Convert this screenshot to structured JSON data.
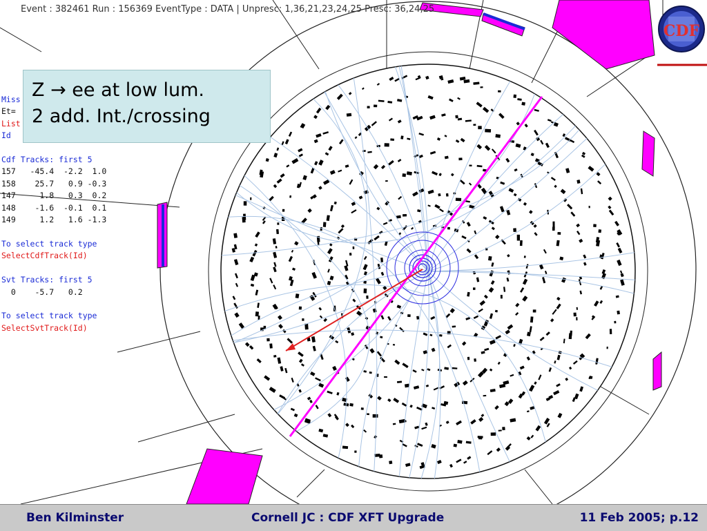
{
  "header": {
    "event_info": "Event : 382461  Run : 156369  EventType : DATA | Unpresc: 1,36,21,23,24,25 Presc: 36,24,25"
  },
  "panel": {
    "lines": [
      {
        "text": "Miss",
        "color": "blue"
      },
      {
        "text": "Et=",
        "color": "black"
      },
      {
        "text": "List",
        "color": "red"
      },
      {
        "text": "Id    pt    phi   eta",
        "color": "blue"
      },
      {
        "text": "",
        "color": "black"
      },
      {
        "text": "Cdf Tracks: first 5",
        "color": "blue"
      },
      {
        "text": "157   -45.4  -2.2  1.0",
        "color": "black"
      },
      {
        "text": "158    25.7   0.9 -0.3",
        "color": "black"
      },
      {
        "text": "147     1.8   0.3  0.2",
        "color": "black"
      },
      {
        "text": "148    -1.6  -0.1  0.1",
        "color": "black"
      },
      {
        "text": "149     1.2   1.6 -1.3",
        "color": "black"
      },
      {
        "text": "",
        "color": "black"
      },
      {
        "text": "To select track type",
        "color": "blue"
      },
      {
        "text": "SelectCdfTrack(Id)",
        "color": "red"
      },
      {
        "text": "",
        "color": "black"
      },
      {
        "text": "Svt Tracks: first 5",
        "color": "blue"
      },
      {
        "text": "  0    -5.7   0.2",
        "color": "black"
      },
      {
        "text": "",
        "color": "black"
      },
      {
        "text": "To select track type",
        "color": "blue"
      },
      {
        "text": "SelectSvtTrack(Id)",
        "color": "red"
      }
    ]
  },
  "callout": {
    "line1": "Z → ee at low lum.",
    "line2": "2 add. Int./crossing"
  },
  "logo": {
    "text": "CDF"
  },
  "footer": {
    "left": "Ben Kilminster",
    "center": "Cornell JC : CDF XFT Upgrade",
    "right": "11 Feb 2005; p.12"
  },
  "colors": {
    "calorimeter": "#ff00ff",
    "track_lines": "#a9c4e4",
    "vertex_rings": "#2b2be0",
    "electron_track": "#e02020",
    "callout_bg": "#cfe9ec",
    "footer_bg": "#c9c9c9",
    "footer_text": "#0a0a70"
  }
}
